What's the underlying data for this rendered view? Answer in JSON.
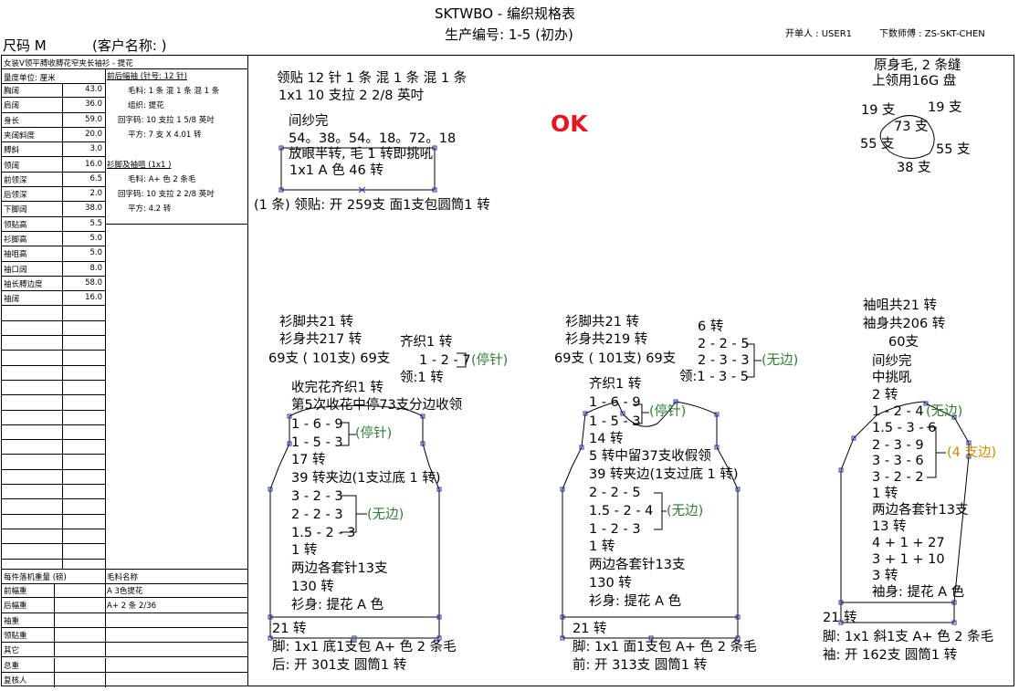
{
  "header": {
    "title": "SKTWBO - 编织规格表",
    "production_no": "生产编号: 1-5 (初办)",
    "size": "尺码  M",
    "client": "(客户名称: )",
    "issuer": "开单人 : USER1",
    "master": "下数师傅 : ZS-SKT-CHEN"
  },
  "left_table": {
    "style_name": "女装V领平膊收膊花窄夹长袖衫 - 提花",
    "unit": "量度单位: 厘米",
    "measurements": [
      {
        "label": "胸阔",
        "value": "43.0"
      },
      {
        "label": "肩阔",
        "value": "36.0"
      },
      {
        "label": "身长",
        "value": "59.0"
      },
      {
        "label": "夹阔斜度",
        "value": "20.0"
      },
      {
        "label": "膊斜",
        "value": "3.0"
      },
      {
        "label": "领阔",
        "value": "16.0"
      },
      {
        "label": "前领深",
        "value": "6.5"
      },
      {
        "label": "后领深",
        "value": "2.0"
      },
      {
        "label": "下脚阔",
        "value": "38.0"
      },
      {
        "label": "领贴高",
        "value": "5.5"
      },
      {
        "label": "衫脚高",
        "value": "5.0"
      },
      {
        "label": "袖咀高",
        "value": "5.0"
      },
      {
        "label": "袖口阔",
        "value": "8.0"
      },
      {
        "label": "袖长膊边度",
        "value": "58.0"
      },
      {
        "label": "袖阔",
        "value": "16.0"
      }
    ],
    "spec_block1": {
      "heading": "前后幅袖 (针号: 12 针)",
      "lines": [
        "毛料: 1 条 混 1 条 混 1 条",
        "组织: 提花",
        "回字码: 10 支拉 1 5/8 英吋",
        "平方: 7 支 X  4.01 转"
      ]
    },
    "spec_block2": {
      "heading": "衫脚及袖咀 (1x1 )",
      "lines": [
        "毛料: A+ 色 2 条毛",
        "回字码: 10 支拉 2 2/8 英吋",
        "平方: 4.2 转"
      ]
    },
    "bottom_header_left": "每件落机重量 (磅)",
    "bottom_header_right": "毛料名称",
    "bottom_rows": [
      {
        "label": "前幅重",
        "value": "A  3色提花"
      },
      {
        "label": "后幅重",
        "value": "A+ 2 条 2/36"
      },
      {
        "label": "袖重",
        "value": ""
      },
      {
        "label": "领贴重",
        "value": ""
      },
      {
        "label": "其它",
        "value": ""
      },
      {
        "label": "总重",
        "value": ""
      },
      {
        "label": "复核人",
        "value": ""
      }
    ]
  },
  "ok_stamp": "OK",
  "collar": {
    "l1": "领贴  12 针 1 条 混 1 条 混 1 条",
    "l2": "1x1   10 支拉 2 2/8 英吋",
    "l3": "间纱完",
    "l4": "54。38。54。18。72。18",
    "l5": "放眼半转, 毛 1 转即挑吼",
    "l6": "1x1  A 色     46 转",
    "l7": "(1 条) 领贴: 开 259支 面1支包圆筒1 转"
  },
  "yarn_note": {
    "l1": "原身毛, 2 条缝",
    "l2": "上领用16G 盘",
    "n_top_left": "19 支",
    "n_top_right": "19 支",
    "n_mid": "73 支",
    "n_left": "55 支",
    "n_right": "55 支",
    "n_bottom": "38 支"
  },
  "back": {
    "l1": "衫脚共21 转",
    "l2": "衫身共217 转",
    "l3": "69支 ( 101支) 69支",
    "qi1": "齐织1 转",
    "sh": "1 - 2 - 7",
    "stop1": "(停针)",
    "ling": "领:1 转",
    "l4": "收完花齐织1 转",
    "l5": "第5次收花中停73支分边收领",
    "r1": "1 - 6 - 9",
    "r2": "1 - 5 - 3",
    "stop2": "(停针)",
    "l6": "17 转",
    "l7": "39 转夹边(1支过底 1 转)",
    "r3": "3 - 2 - 3",
    "r4": "2 - 2 - 3",
    "r5": "1.5 - 2 - 3",
    "noedge": "(无边)",
    "l8": "1 转",
    "l9": "两边各套针13支",
    "l10": "130 转",
    "l11": "衫身: 提花 A 色",
    "l12": "21 转",
    "l13": "脚: 1x1   底1支包 A+ 色 2 条毛",
    "l14": "后: 开 301支 圆筒1 转"
  },
  "front": {
    "l1": "衫脚共21 转",
    "l2": "衫身共219 转",
    "l3": "69支 ( 101支) 69支",
    "six": "6 转",
    "s1": "2 - 2 - 5",
    "s2": "2 - 3 - 3",
    "s3": "领:1 - 3 - 5",
    "noedge1": "(无边)",
    "qi": "齐织1 转",
    "r1": "1 - 6 - 9",
    "r2": "1 - 5 - 3",
    "stop": "(停针)",
    "l4": "14 转",
    "l5": "5 转中留37支收假领",
    "l6": "39 转夹边(1支过底 1 转)",
    "a1": "2 - 2 - 5",
    "a2": "1.5 - 2 - 4",
    "a3": "1 - 2 - 3",
    "noedge2": "(无边)",
    "l7": "1 转",
    "l8": "两边各套针13支",
    "l9": "130 转",
    "l10": "衫身: 提花 A 色",
    "l11": "21 转",
    "l12": "脚: 1x1   面1支包 A+ 色 2 条毛",
    "l13": "前: 开 313支 圆筒1 转"
  },
  "sleeve": {
    "l1": "袖咀共21 转",
    "l2": "袖身共206 转",
    "l3": "60支",
    "l4": "间纱完",
    "l5": "中挑吼",
    "l6": "2 转",
    "r1": "1 - 2 - 4",
    "noedge": "(无边)",
    "r2": "1.5 - 3 - 6",
    "r3": "2 - 3 - 9",
    "r4": "3 - 3 - 6",
    "r5": "3 - 2 - 2",
    "four": "(4 支边)",
    "l7": "1 转",
    "l8": "两边各套针13支",
    "l9": "13 转",
    "l10": "4 + 1 + 27",
    "l11": "3 + 1 + 10",
    "l12": "3 转",
    "l13": "袖身: 提花 A 色",
    "l14": "21 转",
    "l15": "脚: 1x1   斜1支 A+ 色 2 条毛",
    "l16": "袖: 开 162支 圆筒1 转"
  },
  "colors": {
    "ok": "#e8141e",
    "green": "#2e7d32",
    "orange": "#d08a00",
    "handle": "#2233aa"
  }
}
